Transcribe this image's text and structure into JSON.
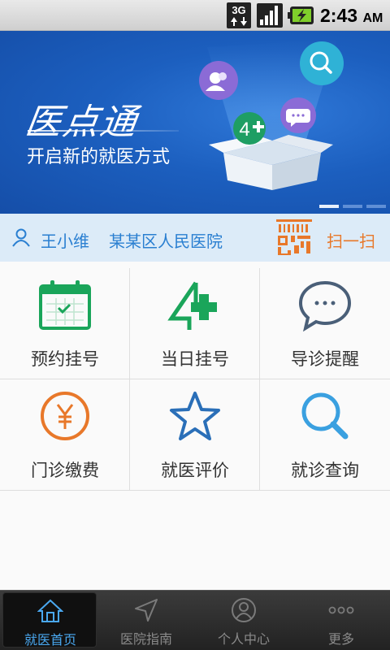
{
  "status_bar": {
    "network": "3G",
    "time": "2:43",
    "ampm": "AM"
  },
  "banner": {
    "logo_text": "医点通",
    "slogan": "开启新的就医方式",
    "slide_count": 3,
    "active_slide": 1
  },
  "user_bar": {
    "user_name": "王小维",
    "hospital": "某某区人民医院",
    "scan_label": "扫一扫"
  },
  "grid": {
    "items": [
      {
        "label": "预约挂号",
        "icon": "calendar-icon"
      },
      {
        "label": "当日挂号",
        "icon": "four-plus-icon"
      },
      {
        "label": "导诊提醒",
        "icon": "chat-bubble-icon"
      },
      {
        "label": "门诊缴费",
        "icon": "yen-coin-icon"
      },
      {
        "label": "就医评价",
        "icon": "star-icon"
      },
      {
        "label": "就诊查询",
        "icon": "search-icon"
      }
    ]
  },
  "tab_bar": {
    "tabs": [
      {
        "label": "就医首页",
        "icon": "home-icon",
        "active": true
      },
      {
        "label": "医院指南",
        "icon": "navigation-arrow-icon",
        "active": false
      },
      {
        "label": "个人中心",
        "icon": "user-icon",
        "active": false
      },
      {
        "label": "更多",
        "icon": "more-dots-icon",
        "active": false
      }
    ]
  },
  "colors": {
    "banner_blue": "#1c5fbf",
    "user_bar_bg": "#dcebf8",
    "link_blue": "#2a7fd1",
    "scan_orange": "#e8782a",
    "green": "#1aa55a",
    "tab_active": "#4aa8f0"
  }
}
